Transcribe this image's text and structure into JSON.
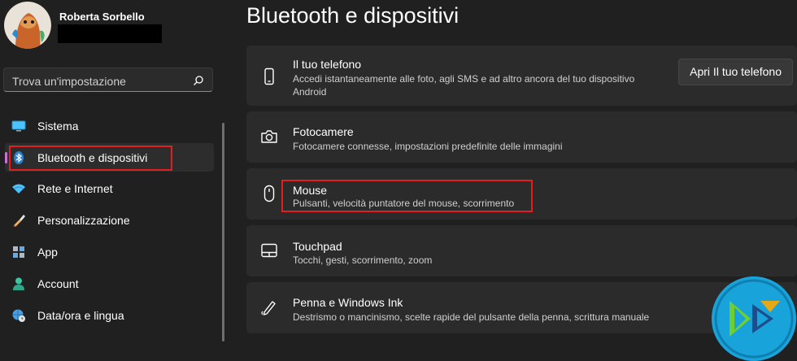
{
  "window": {
    "title": "Bluetooth e dispositivi"
  },
  "user": {
    "name": "Roberta Sorbello"
  },
  "search": {
    "placeholder": "Trova un'impostazione"
  },
  "sidebar": {
    "items": [
      {
        "label": "Sistema",
        "icon": "monitor-icon"
      },
      {
        "label": "Bluetooth e dispositivi",
        "icon": "bluetooth-icon",
        "selected": true
      },
      {
        "label": "Rete e Internet",
        "icon": "wifi-icon"
      },
      {
        "label": "Personalizzazione",
        "icon": "brush-icon"
      },
      {
        "label": "App",
        "icon": "apps-icon"
      },
      {
        "label": "Account",
        "icon": "person-icon"
      },
      {
        "label": "Data/ora e lingua",
        "icon": "globe-clock-icon"
      }
    ]
  },
  "cards": [
    {
      "title": "Il tuo telefono",
      "desc": "Accedi istantaneamente alle foto, agli SMS e ad altro ancora del tuo dispositivo Android",
      "button": "Apri Il tuo telefono",
      "icon": "phone-icon"
    },
    {
      "title": "Fotocamere",
      "desc": "Fotocamere connesse, impostazioni predefinite delle immagini",
      "icon": "camera-icon"
    },
    {
      "title": "Mouse",
      "desc": "Pulsanti, velocità puntatore del mouse, scorrimento",
      "icon": "mouse-icon"
    },
    {
      "title": "Touchpad",
      "desc": "Tocchi, gesti, scorrimento, zoom",
      "icon": "touchpad-icon"
    },
    {
      "title": "Penna e Windows Ink",
      "desc": "Destrismo o mancinismo, scelte rapide del pulsante della penna, scrittura manuale",
      "icon": "pen-icon"
    }
  ],
  "colors": {
    "accent": "#d070d0",
    "highlight": "#e02020",
    "background": "#202020",
    "card": "#2b2b2b"
  }
}
